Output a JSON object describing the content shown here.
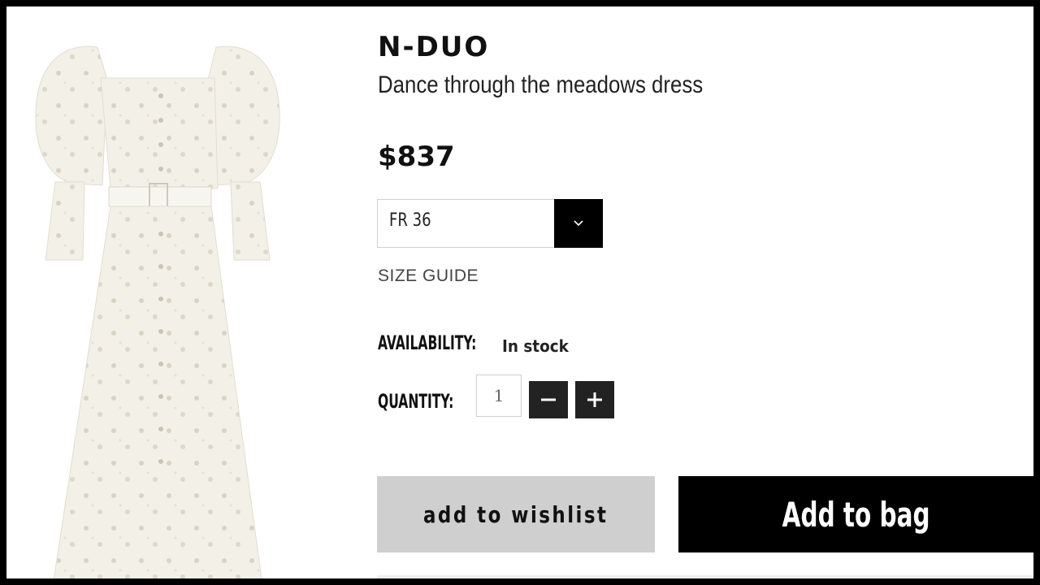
{
  "product": {
    "brand": "N-DUO",
    "name": "Dance through the meadows dress",
    "price": "$837"
  },
  "size": {
    "selected": "FR 36",
    "guide_label": "SIZE GUIDE"
  },
  "availability": {
    "label": "AVAILABILITY:",
    "value": "In stock"
  },
  "quantity": {
    "label": "QUANTITY:",
    "value": "1"
  },
  "actions": {
    "wishlist_label": "add to wishlist",
    "bag_label": "Add to bag"
  },
  "icons": {
    "size_dropdown": "chevron-down-icon",
    "qty_decrease": "minus-icon",
    "qty_increase": "plus-icon"
  },
  "colors": {
    "primary_button": "#000000",
    "secondary_button": "#cfcfcf",
    "qty_button": "#222222",
    "dress": "#f3f0e8"
  }
}
